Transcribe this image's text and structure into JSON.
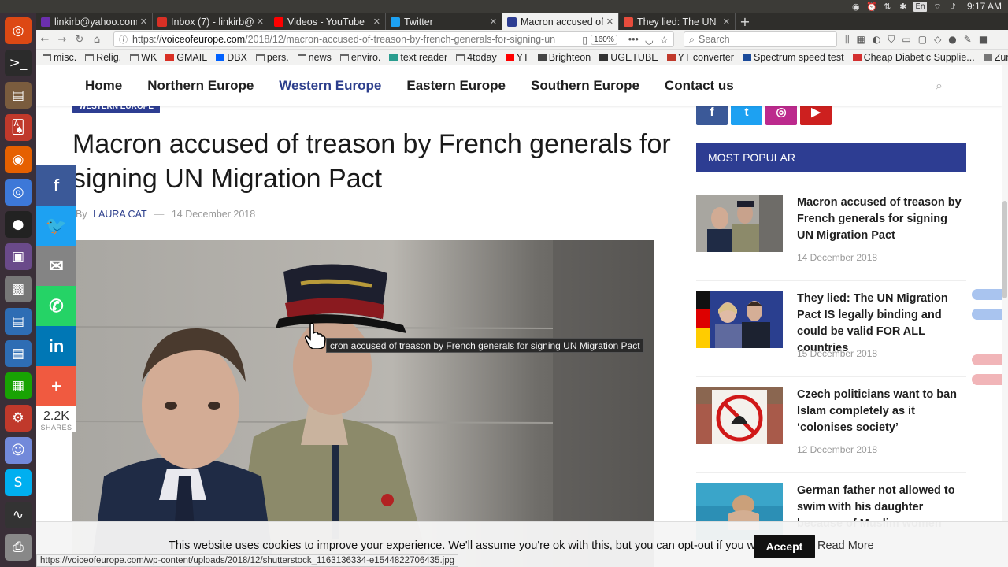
{
  "os": {
    "clock": "9:17 AM",
    "tray_icons": [
      "firefox-tray-icon",
      "alarm-icon",
      "transfer-icon",
      "bluetooth-icon",
      "keyboard-layout-icon",
      "wifi-icon",
      "volume-icon"
    ],
    "keyboard_label": "En"
  },
  "launcher": [
    {
      "name": "ubuntu-logo-icon",
      "glyph": "◎",
      "bg": "#dd4814"
    },
    {
      "name": "terminal-icon",
      "glyph": ">_",
      "bg": "#2b2b2b"
    },
    {
      "name": "files-icon",
      "glyph": "▤",
      "bg": "#7a5c3e"
    },
    {
      "name": "cards-game-icon",
      "glyph": "🂡",
      "bg": "#c0392b"
    },
    {
      "name": "firefox-icon",
      "glyph": "◉",
      "bg": "#e66000"
    },
    {
      "name": "chromium-icon",
      "glyph": "◎",
      "bg": "#3d78d8"
    },
    {
      "name": "obs-icon",
      "glyph": "●",
      "bg": "#222"
    },
    {
      "name": "video-editor-icon",
      "glyph": "▣",
      "bg": "#6a4a8a"
    },
    {
      "name": "screenshot-icon",
      "glyph": "▩",
      "bg": "#777"
    },
    {
      "name": "writer-icon",
      "glyph": "▤",
      "bg": "#2e6db4"
    },
    {
      "name": "writer-doc-icon",
      "glyph": "▤",
      "bg": "#2e6db4"
    },
    {
      "name": "calc-icon",
      "glyph": "▦",
      "bg": "#18a303"
    },
    {
      "name": "settings-icon",
      "glyph": "⚙",
      "bg": "#c0392b"
    },
    {
      "name": "discord-icon",
      "glyph": "☺",
      "bg": "#7289da"
    },
    {
      "name": "skype-icon",
      "glyph": "S",
      "bg": "#00aff0"
    },
    {
      "name": "system-monitor-icon",
      "glyph": "∿",
      "bg": "#333"
    },
    {
      "name": "printer-icon",
      "glyph": "⎙",
      "bg": "#888"
    }
  ],
  "tabs": [
    {
      "title": "linkirb@yahoo.com",
      "fav": "#6b2fae",
      "active": false
    },
    {
      "title": "Inbox (7) - linkirb@g",
      "fav": "#d93025",
      "active": false
    },
    {
      "title": "Videos - YouTube",
      "fav": "#ff0000",
      "active": false
    },
    {
      "title": "Twitter",
      "fav": "#1da1f2",
      "active": false
    },
    {
      "title": "Macron accused of tr",
      "fav": "#2d3d92",
      "active": true
    },
    {
      "title": "They lied: The UN M",
      "fav": "#e74c3c",
      "active": false
    }
  ],
  "address": {
    "scheme": "https://",
    "host": "voiceofeurope.com",
    "path": "/2018/12/macron-accused-of-treason-by-french-generals-for-signing-un",
    "zoom": "160%"
  },
  "search_placeholder": "Search",
  "bookmarks": [
    {
      "label": "misc.",
      "kind": "folder",
      "color": ""
    },
    {
      "label": "Relig.",
      "kind": "folder",
      "color": ""
    },
    {
      "label": "WK",
      "kind": "folder",
      "color": ""
    },
    {
      "label": "GMAIL",
      "kind": "icon",
      "color": "#d93025"
    },
    {
      "label": "DBX",
      "kind": "icon",
      "color": "#0061ff"
    },
    {
      "label": "pers.",
      "kind": "folder",
      "color": ""
    },
    {
      "label": "news",
      "kind": "folder",
      "color": ""
    },
    {
      "label": "enviro.",
      "kind": "folder",
      "color": ""
    },
    {
      "label": "text reader",
      "kind": "icon",
      "color": "#2a9d8f"
    },
    {
      "label": "4today",
      "kind": "folder",
      "color": ""
    },
    {
      "label": "YT",
      "kind": "icon",
      "color": "#ff0000"
    },
    {
      "label": "Brighteon",
      "kind": "icon",
      "color": "#444"
    },
    {
      "label": "UGETUBE",
      "kind": "icon",
      "color": "#333"
    },
    {
      "label": "YT converter",
      "kind": "icon",
      "color": "#c0392b"
    },
    {
      "label": "Spectrum speed test",
      "kind": "icon",
      "color": "#1a4a9a"
    },
    {
      "label": "Cheap Diabetic Supplie...",
      "kind": "icon",
      "color": "#d32f2f"
    },
    {
      "label": "Zum mist",
      "kind": "icon",
      "color": "#777"
    }
  ],
  "site_nav": [
    {
      "label": "Home",
      "active": false
    },
    {
      "label": "Northern Europe",
      "active": false
    },
    {
      "label": "Western Europe",
      "active": true
    },
    {
      "label": "Eastern Europe",
      "active": false
    },
    {
      "label": "Southern Europe",
      "active": false
    },
    {
      "label": "Contact us",
      "active": false
    }
  ],
  "article": {
    "category": "WESTERN EUROPE",
    "headline": "Macron accused of treason by French generals for signing UN Migration Pact",
    "by": "By",
    "author": "LAURA CAT",
    "separator": "—",
    "date": "14 December 2018"
  },
  "share": {
    "count": "2.2K",
    "label": "SHARES",
    "buttons": [
      {
        "name": "facebook-share-button",
        "glyph": "f",
        "bg": "#3b5998"
      },
      {
        "name": "twitter-share-button",
        "glyph": "🐦",
        "bg": "#1da1f2"
      },
      {
        "name": "email-share-button",
        "glyph": "✉",
        "bg": "#848484"
      },
      {
        "name": "whatsapp-share-button",
        "glyph": "✆",
        "bg": "#25d366"
      },
      {
        "name": "linkedin-share-button",
        "glyph": "in",
        "bg": "#0077b5"
      },
      {
        "name": "more-share-button",
        "glyph": "+",
        "bg": "#f05a40"
      }
    ]
  },
  "tooltip": "cron accused of treason by French generals for signing UN Migration Pact",
  "sidebar": {
    "social": [
      {
        "name": "facebook-icon",
        "glyph": "f",
        "bg": "#3b5998"
      },
      {
        "name": "twitter-icon",
        "glyph": "t",
        "bg": "#1da1f2"
      },
      {
        "name": "instagram-icon",
        "glyph": "◎",
        "bg": "#bc2a8d"
      },
      {
        "name": "youtube-icon",
        "glyph": "▶",
        "bg": "#cd201f"
      }
    ],
    "most_popular_label": "MOST POPULAR",
    "items": [
      {
        "title": "Macron accused of treason by French generals for signing UN Migration Pact",
        "date": "14 December 2018"
      },
      {
        "title": "They lied: The UN Migration Pact IS legally binding and could be valid FOR ALL countries",
        "date": "15 December 2018"
      },
      {
        "title": "Czech politicians want to ban Islam completely as it ‘colonises society’",
        "date": "12 December 2018"
      },
      {
        "title": "German father not allowed to swim with his daughter because of Muslim women",
        "date": ""
      }
    ]
  },
  "cookie": {
    "text": "This website uses cookies to improve your experience. We'll assume you're ok with this, but you can opt-out if you wish.",
    "accept": "Accept",
    "read_more": "Read More"
  },
  "status_url": "https://voiceofeurope.com/wp-content/uploads/2018/12/shutterstock_1163136334-e1544822706435.jpg"
}
